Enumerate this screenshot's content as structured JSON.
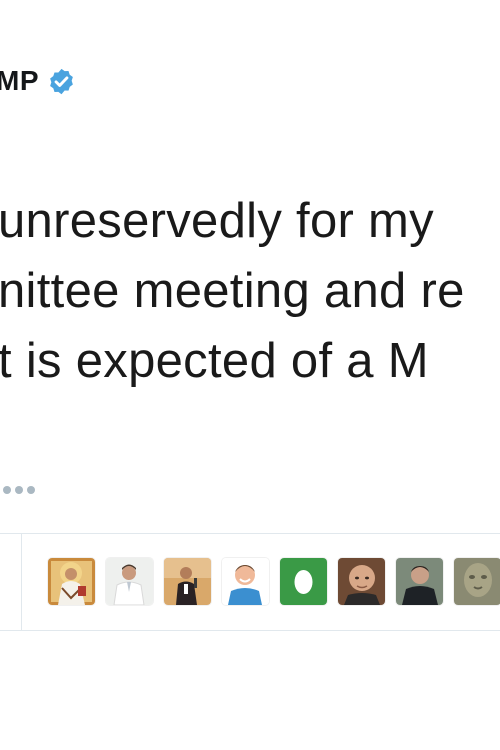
{
  "header": {
    "display_name": "MP",
    "verified": true,
    "verified_icon": "verified-badge-icon",
    "verified_color": "#4aa3df"
  },
  "tweet": {
    "lines": [
      "unreservedly for my",
      "nittee meeting and re",
      "t is expected of a M"
    ]
  },
  "actions": {
    "more_icon": "more-dots-icon"
  },
  "liked_by": {
    "avatars": [
      {
        "icon": "religious-painting-avatar"
      },
      {
        "icon": "man-white-shirt-avatar"
      },
      {
        "icon": "man-speaking-avatar"
      },
      {
        "icon": "smiling-man-avatar"
      },
      {
        "icon": "green-egg-avatar"
      },
      {
        "icon": "bald-man-avatar"
      },
      {
        "icon": "man-dark-jacket-avatar"
      },
      {
        "icon": "statue-face-avatar"
      }
    ]
  }
}
